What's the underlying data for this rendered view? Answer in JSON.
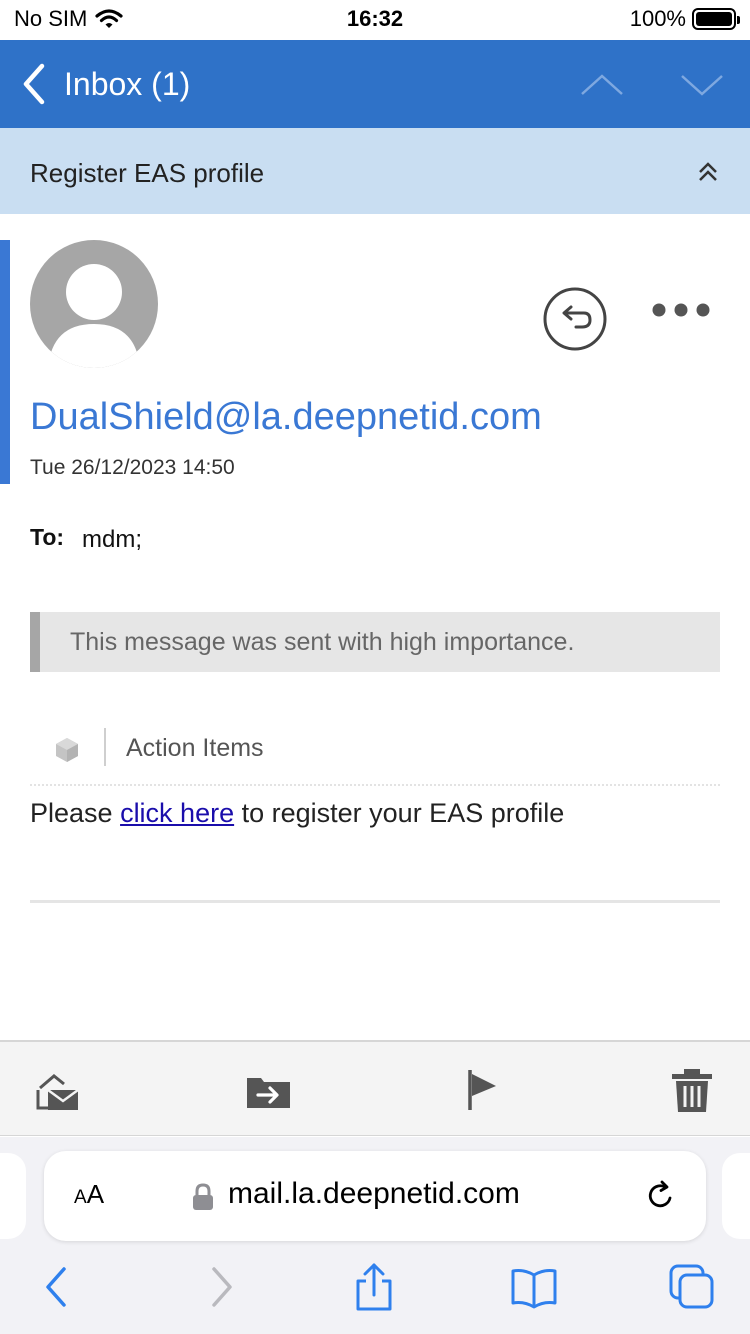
{
  "status_bar": {
    "carrier": "No SIM",
    "time": "16:32",
    "battery": "100%"
  },
  "nav": {
    "title": "Inbox (1)"
  },
  "subject": "Register EAS profile",
  "message": {
    "sender": "DualShield@la.deepnetid.com",
    "datetime": "Tue 26/12/2023 14:50",
    "to_label": "To:",
    "to_value": "mdm;",
    "importance_notice": "This message was sent with high importance.",
    "action_items_label": "Action Items",
    "body_before": "Please ",
    "body_link": "click here",
    "body_after": " to register your EAS profile"
  },
  "safari": {
    "text_size_label": "AA",
    "url": "mail.la.deepnetid.com"
  },
  "colors": {
    "header_blue": "#2f72c8",
    "subject_bg": "#c9def2",
    "sender_blue": "#3a78d4",
    "ios_blue": "#2f80ed"
  }
}
